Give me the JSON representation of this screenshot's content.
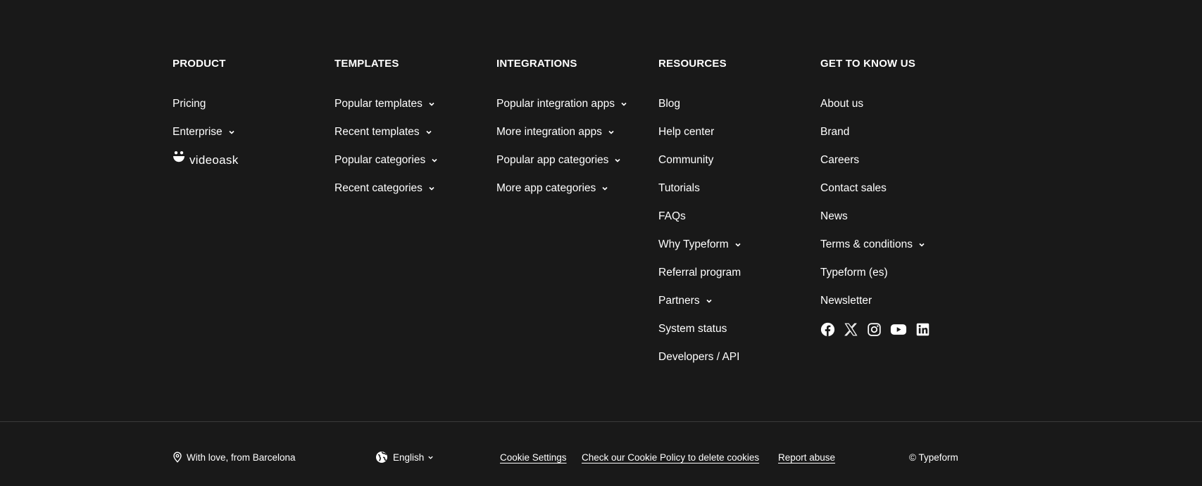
{
  "columns": [
    {
      "title": "PRODUCT",
      "items": [
        {
          "label": "Pricing",
          "chevron": false
        },
        {
          "label": "Enterprise",
          "chevron": true
        }
      ],
      "extra_logo": "videoask"
    },
    {
      "title": "TEMPLATES",
      "items": [
        {
          "label": "Popular templates",
          "chevron": true
        },
        {
          "label": "Recent templates",
          "chevron": true
        },
        {
          "label": "Popular categories",
          "chevron": true
        },
        {
          "label": "Recent categories",
          "chevron": true
        }
      ]
    },
    {
      "title": "INTEGRATIONS",
      "items": [
        {
          "label": "Popular integration apps",
          "chevron": true
        },
        {
          "label": "More integration apps",
          "chevron": true
        },
        {
          "label": "Popular app categories",
          "chevron": true
        },
        {
          "label": "More app categories",
          "chevron": true
        }
      ]
    },
    {
      "title": "RESOURCES",
      "items": [
        {
          "label": "Blog",
          "chevron": false
        },
        {
          "label": "Help center",
          "chevron": false
        },
        {
          "label": "Community",
          "chevron": false
        },
        {
          "label": "Tutorials",
          "chevron": false
        },
        {
          "label": "FAQs",
          "chevron": false
        },
        {
          "label": "Why Typeform",
          "chevron": true
        },
        {
          "label": "Referral program",
          "chevron": false
        },
        {
          "label": "Partners",
          "chevron": true
        },
        {
          "label": "System status",
          "chevron": false
        },
        {
          "label": "Developers / API",
          "chevron": false
        }
      ]
    },
    {
      "title": "GET TO KNOW US",
      "items": [
        {
          "label": "About us",
          "chevron": false
        },
        {
          "label": "Brand",
          "chevron": false
        },
        {
          "label": "Careers",
          "chevron": false
        },
        {
          "label": "Contact sales",
          "chevron": false
        },
        {
          "label": "News",
          "chevron": false
        },
        {
          "label": "Terms & conditions",
          "chevron": true
        },
        {
          "label": "Typeform (es)",
          "chevron": false
        },
        {
          "label": "Newsletter",
          "chevron": false
        }
      ],
      "social": [
        "facebook-icon",
        "x-twitter-icon",
        "instagram-icon",
        "youtube-icon",
        "linkedin-icon"
      ]
    }
  ],
  "bottom": {
    "location": "With love, from Barcelona",
    "language": "English",
    "cookie_settings": "Cookie Settings",
    "cookie_policy": "Check our Cookie Policy to delete cookies",
    "report_abuse": "Report abuse",
    "copyright": "© Typeform"
  },
  "colors": {
    "background": "#191919",
    "text": "#ffffff",
    "divider": "#3a3a3a"
  }
}
